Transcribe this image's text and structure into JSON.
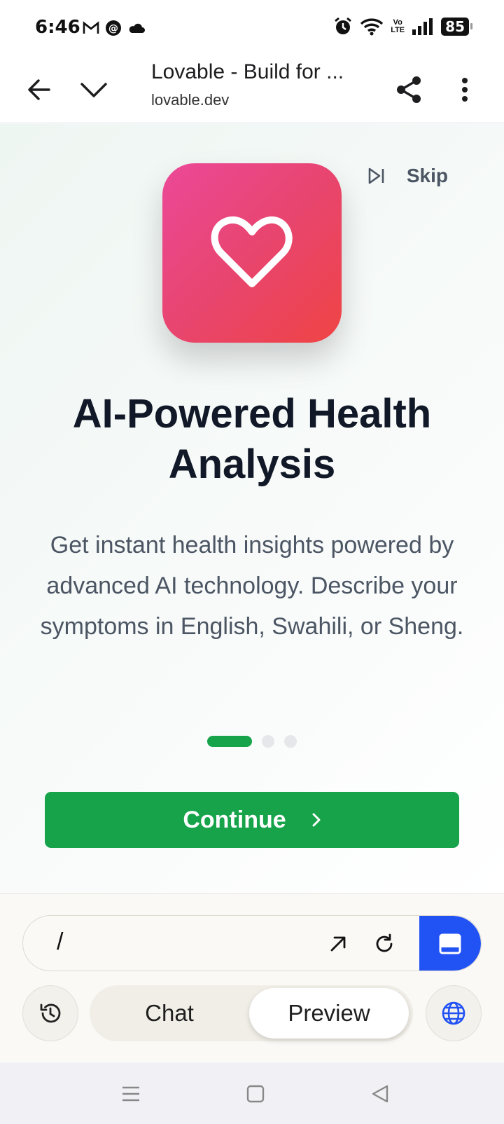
{
  "status_bar": {
    "time": "6:46",
    "battery": "85",
    "volte_line1": "Vo",
    "volte_line2": "LTE",
    "left_icons": [
      "gmail-icon",
      "threads-icon",
      "cloud-icon"
    ],
    "right_icons": [
      "alarm-icon",
      "wifi-icon",
      "volte-icon",
      "signal-icon",
      "battery-icon"
    ]
  },
  "browser": {
    "title": "Lovable - Build for ...",
    "url": "lovable.dev",
    "icons": [
      "back-arrow-icon",
      "chevron-down-icon",
      "share-icon",
      "more-vert-icon"
    ]
  },
  "onboarding": {
    "skip_label": "Skip",
    "headline": "AI-Powered Health Analysis",
    "description": "Get instant health insights powered by advanced AI technology. Describe your symptoms in English, Swahili, or Sheng.",
    "page_count": 3,
    "current_page": 1,
    "continue_label": "Continue",
    "app_icon": "heart-icon",
    "colors": {
      "accent_green": "#16a34a",
      "tile_pink": "#ec4899",
      "tile_red": "#ef4444"
    }
  },
  "bottom": {
    "path": "/",
    "chat_label": "Chat",
    "preview_label": "Preview",
    "active_tab": "Preview",
    "accent_blue": "#2152f3"
  }
}
